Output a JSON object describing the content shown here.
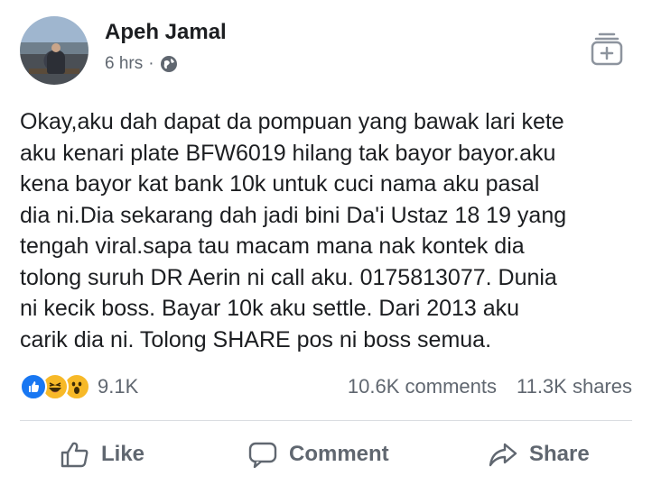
{
  "post": {
    "author": "Apeh Jamal",
    "time": "6 hrs",
    "separator": "·",
    "privacy_icon": "globe-icon",
    "text": "Okay,aku dah dapat da pompuan yang bawak lari kete\naku kenari plate BFW6019 hilang tak bayor bayor.aku\nkena bayor kat bank 10k untuk cuci nama aku pasal\ndia ni.Dia sekarang dah jadi bini Da'i Ustaz 18 19 yang\ntengah viral.sapa tau macam mana nak kontek dia\ntolong suruh DR Aerin ni call aku. 0175813077. Dunia\nni kecik boss. Bayar 10k aku settle. Dari 2013 aku\ncarik dia ni. Tolong SHARE pos ni boss semua."
  },
  "reactions": {
    "icons": [
      "like-reaction-icon",
      "haha-reaction-icon",
      "wow-reaction-icon"
    ],
    "count": "9.1K"
  },
  "stats": {
    "comments": "10.6K comments",
    "shares": "11.3K shares"
  },
  "actions": {
    "like": "Like",
    "comment": "Comment",
    "share": "Share"
  },
  "colors": {
    "like_blue": "#1877f2",
    "emoji_yellow": "#f7b928",
    "meta_gray": "#606770"
  }
}
